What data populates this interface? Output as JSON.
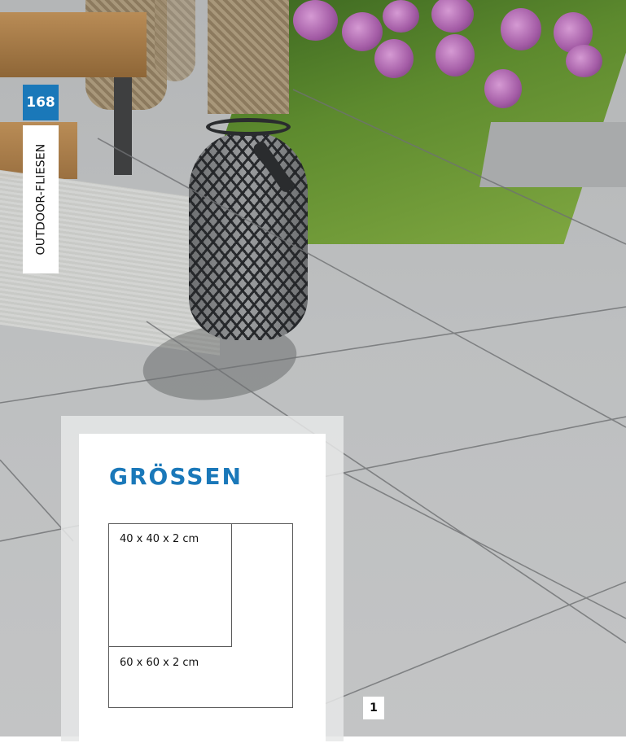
{
  "page": {
    "number": "168",
    "section": "OUTDOOR-FLIESEN"
  },
  "sizes_panel": {
    "title": "GRÖSSEN",
    "tiles": [
      {
        "label": "40 x 40 x 2 cm"
      },
      {
        "label": "60 x 60 x 2 cm"
      }
    ]
  },
  "image_ref": "1",
  "colors": {
    "accent": "#1a78b9",
    "panel_bg": "#ffffff"
  }
}
